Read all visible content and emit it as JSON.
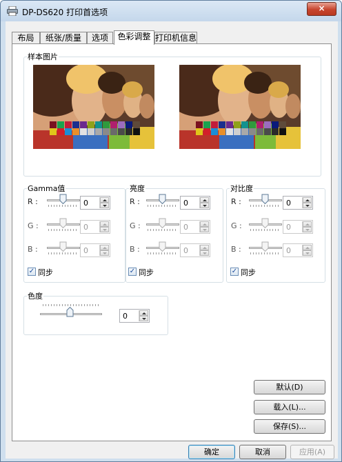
{
  "window": {
    "title": "DP-DS620 打印首选项",
    "close_label": "×"
  },
  "tabs": [
    "布局",
    "纸张/质量",
    "选项",
    "色彩调整",
    "打印机信息"
  ],
  "active_tab": 3,
  "sample": {
    "legend": "样本图片"
  },
  "gamma": {
    "legend": "Gamma值",
    "rows": [
      {
        "label": "R :",
        "value": "0"
      },
      {
        "label": "G :",
        "value": "0"
      },
      {
        "label": "B :",
        "value": "0"
      }
    ],
    "sync_label": "同步"
  },
  "brightness": {
    "legend": "亮度",
    "rows": [
      {
        "label": "R :",
        "value": "0"
      },
      {
        "label": "G :",
        "value": "0"
      },
      {
        "label": "B :",
        "value": "0"
      }
    ],
    "sync_label": "同步"
  },
  "contrast": {
    "legend": "对比度",
    "rows": [
      {
        "label": "R :",
        "value": "0"
      },
      {
        "label": "G :",
        "value": "0"
      },
      {
        "label": "B :",
        "value": "0"
      }
    ],
    "sync_label": "同步"
  },
  "saturation": {
    "legend": "色度",
    "value": "0"
  },
  "side_buttons": {
    "default": "默认(D)",
    "load": "载入(L)...",
    "save": "保存(S)..."
  },
  "footer": {
    "ok": "确定",
    "cancel": "取消",
    "apply": "应用(A)"
  },
  "swatch_colors": [
    "#7a1220",
    "#19a34f",
    "#c21d3a",
    "#1b2f8e",
    "#6a2a8f",
    "#8fa21a",
    "#12928f",
    "#2f9a3d",
    "#b01e6e",
    "#9b6cbf",
    "#0a1a7a",
    "#5e4a3a",
    "#e0c61a",
    "#d31f2a",
    "#1b8ed6",
    "#e88f2a",
    "#e2e2e2",
    "#cfcfcf",
    "#a9a9a9",
    "#8a8a8a",
    "#6a6a6a",
    "#4a4a4a",
    "#2a2a2a",
    "#111111"
  ],
  "accent_colors": {
    "title_bar": "#cfdfee",
    "close_button": "#c7452e",
    "default_button_border": "#3c7fb1"
  }
}
